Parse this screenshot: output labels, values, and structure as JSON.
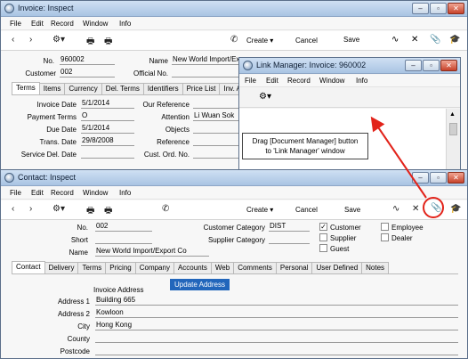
{
  "invoice_window": {
    "title": "Invoice: Inspect",
    "menu": [
      "File",
      "Edit",
      "Record",
      "Window",
      "Info"
    ],
    "toolbar": {
      "back": "‹",
      "forward": "›",
      "create": "Create",
      "cancel": "Cancel",
      "save": "Save"
    },
    "fields": {
      "no_label": "No.",
      "no_value": "960002",
      "customer_label": "Customer",
      "customer_value": "002",
      "name_label": "Name",
      "name_value": "New World Import/Expor",
      "official_label": "Official No."
    },
    "tabs": [
      "Terms",
      "Items",
      "Currency",
      "Del. Terms",
      "Identifiers",
      "Price List",
      "Inv. Add"
    ],
    "terms": {
      "invoice_date_label": "Invoice Date",
      "invoice_date": "5/1/2014",
      "payment_terms_label": "Payment Terms",
      "payment_terms": "O",
      "due_date_label": "Due Date",
      "due_date": "5/1/2014",
      "trans_date_label": "Trans. Date",
      "trans_date": "29/8/2008",
      "service_del_date_label": "Service Del. Date",
      "our_reference_label": "Our Reference",
      "attention_label": "Attention",
      "attention": "Li Wuan Sok",
      "objects_label": "Objects",
      "reference_label": "Reference",
      "cust_ord_label": "Cust. Ord. No."
    }
  },
  "link_manager": {
    "title": "Link Manager: Invoice: 960002",
    "menu": [
      "File",
      "Edit",
      "Record",
      "Window",
      "Info"
    ]
  },
  "callout": {
    "line1": "Drag [Document Manager] button",
    "line2": "to 'Link Manager' window"
  },
  "contact_window": {
    "title": "Contact: Inspect",
    "menu": [
      "File",
      "Edit",
      "Record",
      "Window",
      "Info"
    ],
    "toolbar": {
      "back": "‹",
      "forward": "›",
      "create": "Create",
      "cancel": "Cancel",
      "save": "Save"
    },
    "fields": {
      "no_label": "No.",
      "no_value": "002",
      "short_label": "Short",
      "name_label": "Name",
      "name_value": "New World Import/Export Co",
      "customer_category_label": "Customer Category",
      "customer_category": "DIST",
      "supplier_category_label": "Supplier Category"
    },
    "checkboxes": {
      "customer": "Customer",
      "customer_checked": true,
      "supplier": "Supplier",
      "guest": "Guest",
      "employee": "Employee",
      "dealer": "Dealer"
    },
    "tabs": [
      "Contact",
      "Delivery",
      "Terms",
      "Pricing",
      "Company",
      "Accounts",
      "Web",
      "Comments",
      "Personal",
      "User Defined",
      "Notes"
    ],
    "contact_tab": {
      "invoice_address_label": "Invoice Address",
      "update_address": "Update Address",
      "address1_label": "Address 1",
      "address1": "Building 665",
      "address2_label": "Address 2",
      "address2": "Kowloon",
      "city_label": "City",
      "city": "Hong Kong",
      "county_label": "County",
      "postcode_label": "Postcode"
    }
  },
  "colors": {
    "arrow": "#e2231a",
    "update_button": "#2266bb",
    "close_button": "#c7432b"
  }
}
